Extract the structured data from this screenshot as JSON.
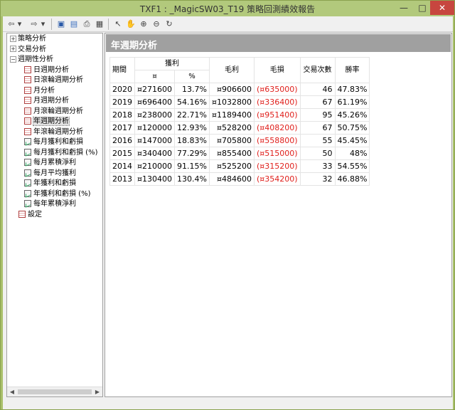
{
  "window": {
    "title": "TXF1 : _MagicSW03_T19 策略回測績效報告",
    "minimize_glyph": "—",
    "maximize_glyph": "□",
    "close_glyph": "✕"
  },
  "toolbar": {
    "back_glyph": "⇦",
    "back_dropdown_glyph": "▾",
    "forward_glyph": "⇨",
    "forward_dropdown_glyph": "▾",
    "save_glyph": "▣",
    "preview_glyph": "▤",
    "print_glyph": "⎙",
    "table_glyph": "▦",
    "pointer_glyph": "↖",
    "hand_glyph": "✋",
    "zoom_in_glyph": "⊕",
    "zoom_out_glyph": "⊖",
    "refresh_glyph": "↻"
  },
  "tree": {
    "collapsed_glyph": "+",
    "expanded_glyph": "−",
    "items": [
      {
        "label": "策略分析",
        "level": 0,
        "expander": "collapsed",
        "icon": "none"
      },
      {
        "label": "交易分析",
        "level": 0,
        "expander": "collapsed",
        "icon": "none"
      },
      {
        "label": "週期性分析",
        "level": 0,
        "expander": "expanded",
        "icon": "none"
      },
      {
        "label": "日週期分析",
        "level": 1,
        "icon": "table"
      },
      {
        "label": "日滾輪週期分析",
        "level": 1,
        "icon": "table"
      },
      {
        "label": "月分析",
        "level": 1,
        "icon": "table"
      },
      {
        "label": "月週期分析",
        "level": 1,
        "icon": "table"
      },
      {
        "label": "月滾輪週期分析",
        "level": 1,
        "icon": "table"
      },
      {
        "label": "年週期分析",
        "level": 1,
        "icon": "table",
        "selected": true
      },
      {
        "label": "年滾輪週期分析",
        "level": 1,
        "icon": "table"
      },
      {
        "label": "每月獲利和虧損",
        "level": 1,
        "icon": "chart"
      },
      {
        "label": "每月獲利和虧損 (%)",
        "level": 1,
        "icon": "chart"
      },
      {
        "label": "每月累積淨利",
        "level": 1,
        "icon": "chart"
      },
      {
        "label": "每月平均獲利",
        "level": 1,
        "icon": "chart"
      },
      {
        "label": "年獲利和虧損",
        "level": 1,
        "icon": "chart"
      },
      {
        "label": "年獲利和虧損 (%)",
        "level": 1,
        "icon": "chart"
      },
      {
        "label": "每年累積淨利",
        "level": 1,
        "icon": "chart"
      },
      {
        "label": "設定",
        "level": 0,
        "icon": "table"
      }
    ],
    "scroll_left_glyph": "◀",
    "scroll_right_glyph": "▶"
  },
  "report": {
    "title": "年週期分析",
    "headers": {
      "period": "期間",
      "profit": "獲利",
      "profit_currency": "¤",
      "profit_pct": "%",
      "gross_profit": "毛利",
      "gross_loss": "毛損",
      "trades": "交易次數",
      "win_rate": "勝率"
    },
    "rows": [
      {
        "period": "2020",
        "profit": "¤271600",
        "pct": "13.7%",
        "gross_profit": "¤906600",
        "gross_loss": "(¤635000)",
        "trades": "46",
        "win_rate": "47.83%"
      },
      {
        "period": "2019",
        "profit": "¤696400",
        "pct": "54.16%",
        "gross_profit": "¤1032800",
        "gross_loss": "(¤336400)",
        "trades": "67",
        "win_rate": "61.19%"
      },
      {
        "period": "2018",
        "profit": "¤238000",
        "pct": "22.71%",
        "gross_profit": "¤1189400",
        "gross_loss": "(¤951400)",
        "trades": "95",
        "win_rate": "45.26%"
      },
      {
        "period": "2017",
        "profit": "¤120000",
        "pct": "12.93%",
        "gross_profit": "¤528200",
        "gross_loss": "(¤408200)",
        "trades": "67",
        "win_rate": "50.75%"
      },
      {
        "period": "2016",
        "profit": "¤147000",
        "pct": "18.83%",
        "gross_profit": "¤705800",
        "gross_loss": "(¤558800)",
        "trades": "55",
        "win_rate": "45.45%"
      },
      {
        "period": "2015",
        "profit": "¤340400",
        "pct": "77.29%",
        "gross_profit": "¤855400",
        "gross_loss": "(¤515000)",
        "trades": "50",
        "win_rate": "48%"
      },
      {
        "period": "2014",
        "profit": "¤210000",
        "pct": "91.15%",
        "gross_profit": "¤525200",
        "gross_loss": "(¤315200)",
        "trades": "33",
        "win_rate": "54.55%"
      },
      {
        "period": "2013",
        "profit": "¤130400",
        "pct": "130.4%",
        "gross_profit": "¤484600",
        "gross_loss": "(¤354200)",
        "trades": "32",
        "win_rate": "46.88%"
      }
    ]
  },
  "colors": {
    "negative": "#e0201c",
    "header_bar": "#a0a0a0",
    "window_frame": "#a9c06a"
  }
}
